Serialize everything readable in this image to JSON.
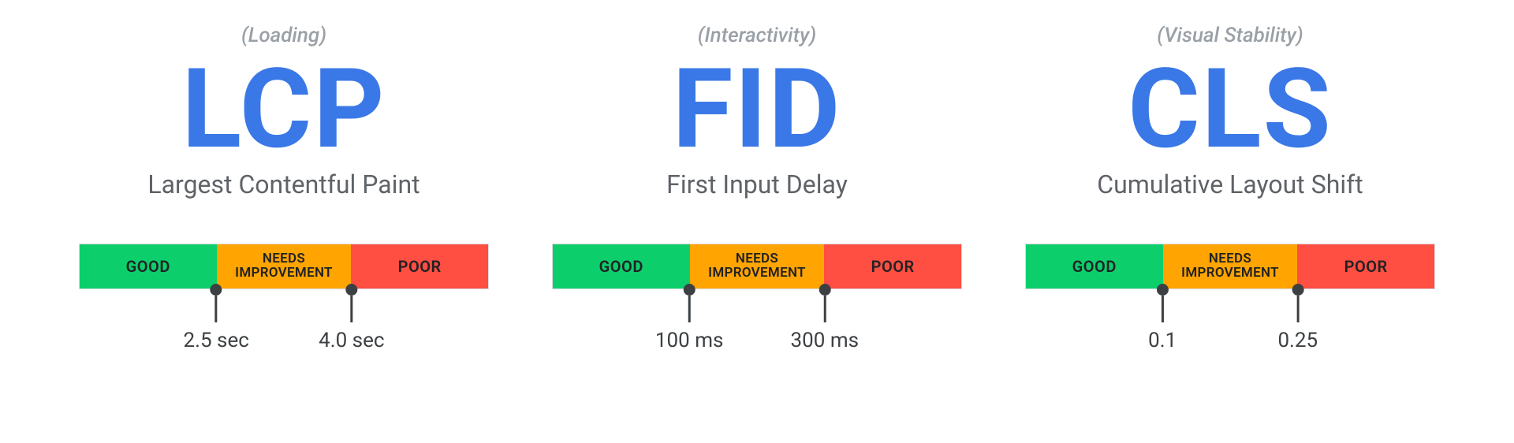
{
  "colors": {
    "accent": "#3b78e7",
    "good": "#0cce6b",
    "needs": "#ffa400",
    "poor": "#ff4e42",
    "text_muted": "#9aa0a6",
    "text_body": "#5f6368",
    "text_dark": "#3c4043"
  },
  "segment_labels": {
    "good": "GOOD",
    "needs": "NEEDS\nIMPROVEMENT",
    "poor": "POOR"
  },
  "metrics": [
    {
      "category": "(Loading)",
      "abbr": "LCP",
      "fullname": "Largest Contentful Paint",
      "segments": {
        "good_pct": 33.5,
        "needs_pct": 33,
        "poor_pct": 33.5
      },
      "thresholds": [
        {
          "pos_pct": 33.5,
          "label": "2.5 sec"
        },
        {
          "pos_pct": 66.5,
          "label": "4.0 sec"
        }
      ]
    },
    {
      "category": "(Interactivity)",
      "abbr": "FID",
      "fullname": "First Input Delay",
      "segments": {
        "good_pct": 33.5,
        "needs_pct": 33,
        "poor_pct": 33.5
      },
      "thresholds": [
        {
          "pos_pct": 33.5,
          "label": "100 ms"
        },
        {
          "pos_pct": 66.5,
          "label": "300 ms"
        }
      ]
    },
    {
      "category": "(Visual Stability)",
      "abbr": "CLS",
      "fullname": "Cumulative Layout Shift",
      "segments": {
        "good_pct": 33.5,
        "needs_pct": 33,
        "poor_pct": 33.5
      },
      "thresholds": [
        {
          "pos_pct": 33.5,
          "label": "0.1"
        },
        {
          "pos_pct": 66.5,
          "label": "0.25"
        }
      ]
    }
  ]
}
